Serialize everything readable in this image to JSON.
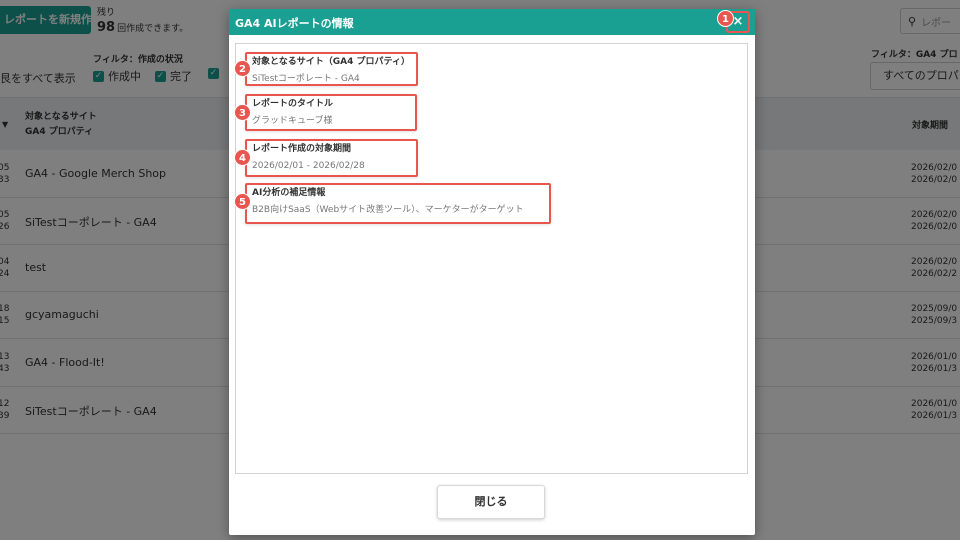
{
  "header": {
    "new_report_label": "ートを新規作成",
    "remaining_label": "残り",
    "remaining_count": "98",
    "remaining_suffix": "回作成できます。",
    "search_icon": "search-icon",
    "search_placeholder": "レポー"
  },
  "filters": {
    "status_label": "フィルタ：作成の状況",
    "show_all": "艮をすべて表示",
    "options": [
      "作成中",
      "完了",
      ""
    ],
    "property_label": "フィルタ：GA4 プロ",
    "property_value": "すべてのプロパ"
  },
  "table": {
    "col_site_line1": "対象となるサイト",
    "col_site_line2": "GA4 プロパティ",
    "col_period": "対象期間",
    "rows": [
      {
        "d1": "05",
        "d2": "33",
        "name": "GA4 - Google Merch Shop",
        "p1": "2026/02/0",
        "p2": "2026/02/0"
      },
      {
        "d1": "05",
        "d2": "26",
        "name": "SiTestコーポレート - GA4",
        "p1": "2026/02/0",
        "p2": "2026/02/0"
      },
      {
        "d1": "04",
        "d2": "24",
        "name": "test",
        "p1": "2026/02/0",
        "p2": "2026/02/2"
      },
      {
        "d1": "18",
        "d2": "15",
        "name": "gcyamaguchi",
        "p1": "2025/09/0",
        "p2": "2025/09/3"
      },
      {
        "d1": "13",
        "d2": "43",
        "name": "GA4 - Flood-It!",
        "p1": "2026/01/0",
        "p2": "2026/01/3"
      },
      {
        "d1": "12",
        "d2": "39",
        "name": "SiTestコーポレート - GA4",
        "p1": "2026/01/0",
        "p2": "2026/01/3"
      }
    ]
  },
  "modal": {
    "title": "GA4 AIレポートの情報",
    "close_icon": "×",
    "fields": {
      "site_label": "対象となるサイト（GA4 プロパティ）",
      "site_value": "SiTestコーポレート - GA4",
      "title_label": "レポートのタイトル",
      "title_value": "グラッドキューブ様",
      "period_label": "レポート作成の対象期間",
      "period_value": "2026/02/01 - 2026/02/28",
      "notes_label": "AI分析の補足情報",
      "notes_value": "B2B向けSaaS（Webサイト改善ツール）、マーケターがターゲット"
    },
    "close_button": "閉じる"
  },
  "annotations": [
    "1",
    "2",
    "3",
    "4",
    "5"
  ],
  "colors": {
    "accent": "#1a9f93",
    "highlight": "#e8564f"
  }
}
